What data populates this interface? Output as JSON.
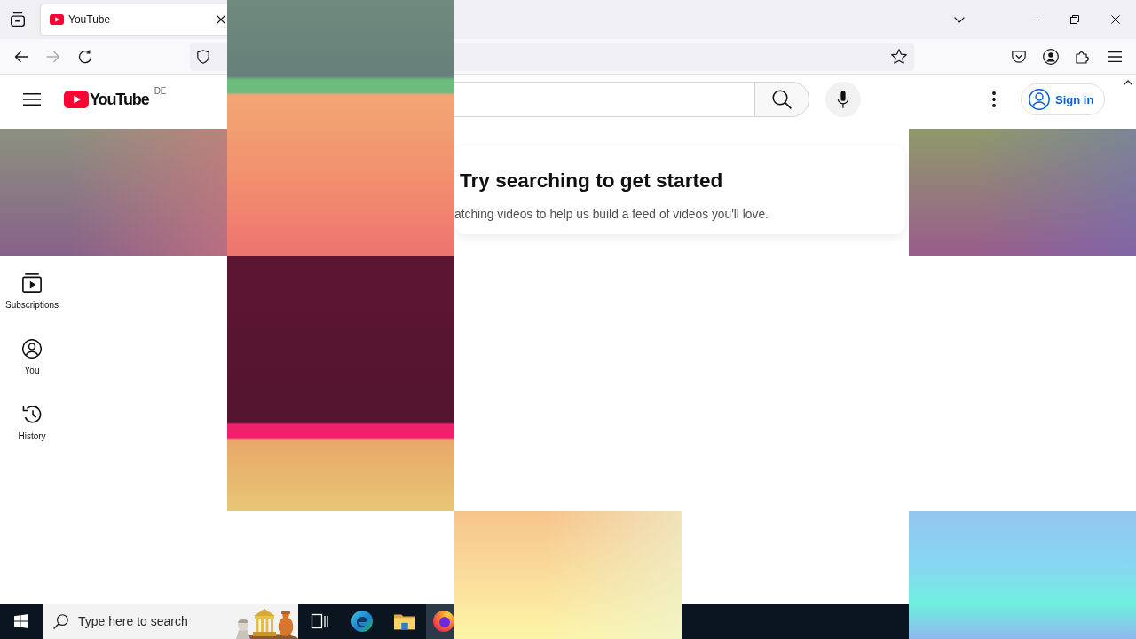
{
  "browser": {
    "tabs": [
      {
        "title": "YouTube",
        "selected": true
      }
    ],
    "navigation": {
      "back": {
        "disabled": false
      },
      "forward": {
        "disabled": true
      }
    }
  },
  "youtube": {
    "logo": {
      "wordmark": "YouTube",
      "region": "DE"
    },
    "sign_in": "Sign in",
    "sidebar": {
      "items": [
        {
          "label": "Subscriptions",
          "selected": false
        },
        {
          "label": "You",
          "selected": false
        },
        {
          "label": "History",
          "selected": false
        }
      ]
    },
    "prompt": {
      "title": "Try searching to get started",
      "subtitle": "atching videos to help us build a feed of videos you'll love."
    }
  },
  "taskbar": {
    "search": {
      "placeholder": "Type here to search"
    },
    "apps": [
      {
        "selected": false
      },
      {
        "selected": false
      },
      {
        "selected": false
      },
      {
        "selected": true
      }
    ]
  }
}
